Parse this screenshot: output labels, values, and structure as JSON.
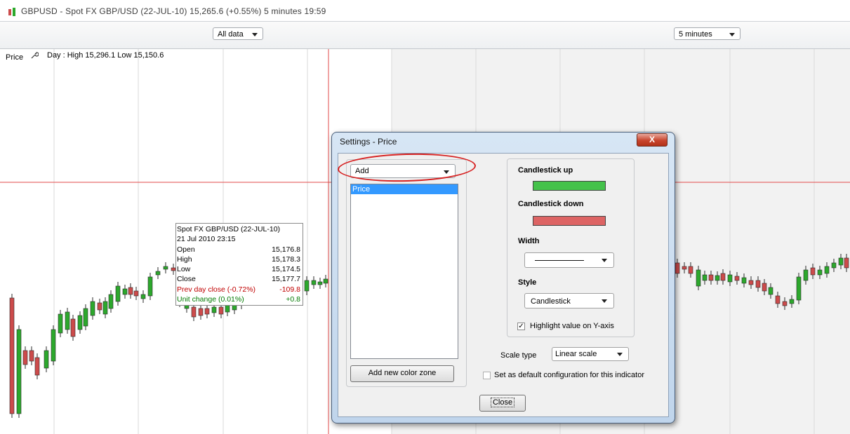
{
  "window": {
    "title": "GBPUSD - Spot FX GBP/USD (22-JUL-10)   15,265.6 (+0.55%)   5 minutes  19:59"
  },
  "toolbar": {
    "range_select": "All data",
    "interval_select": "5 minutes"
  },
  "chart": {
    "price_label": "Price",
    "wrench_icon": "wrench-icon",
    "day_info": "Day : High 15,296.1 Low 15,150.6",
    "colors": {
      "up": "#2ca82c",
      "down": "#cc4b4b",
      "crosshair": "#e24a4a",
      "grid": "#d9d9d9",
      "shade": "#f2f2f2"
    }
  },
  "tooltip": {
    "title": "Spot FX GBP/USD (22-JUL-10)",
    "datetime": "21 Jul 2010 23:15",
    "rows": [
      {
        "label": "Open",
        "value": "15,176.8"
      },
      {
        "label": "High",
        "value": "15,178.3"
      },
      {
        "label": "Low",
        "value": "15,174.5"
      },
      {
        "label": "Close",
        "value": "15,177.7"
      },
      {
        "label": "Prev day close (-0.72%)",
        "value": "-109.8"
      },
      {
        "label": "Unit change (0.01%)",
        "value": "+0.8"
      }
    ]
  },
  "dialog": {
    "title": "Settings - Price",
    "close_icon": "X",
    "add_select": "Add",
    "list_items": [
      "Price"
    ],
    "add_zone_button": "Add new color zone",
    "candle_up_label": "Candlestick up",
    "candle_up_color": "#44c24a",
    "candle_down_label": "Candlestick down",
    "candle_down_color": "#dd6464",
    "width_label": "Width",
    "style_label": "Style",
    "style_value": "Candlestick",
    "highlight_label": "Highlight value on Y-axis",
    "highlight_checked": true,
    "scale_type_label": "Scale type",
    "scale_type_value": "Linear scale",
    "default_config_label": "Set as default configuration for this indicator",
    "default_config_checked": false,
    "close_button": "Close"
  }
}
